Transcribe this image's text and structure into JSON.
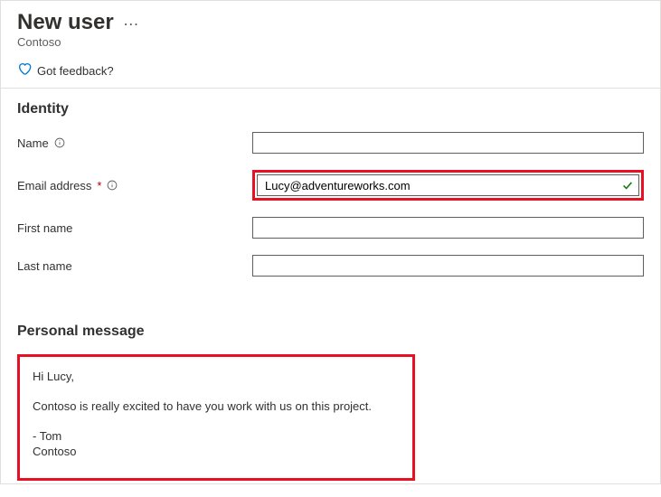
{
  "header": {
    "title": "New user",
    "org": "Contoso",
    "feedback_label": "Got feedback?"
  },
  "sections": {
    "identity": {
      "heading": "Identity",
      "fields": {
        "name_label": "Name",
        "name_value": "",
        "email_label": "Email address",
        "email_value": "Lucy@adventureworks.com",
        "first_name_label": "First name",
        "first_name_value": "",
        "last_name_label": "Last name",
        "last_name_value": ""
      }
    },
    "personal_message": {
      "heading": "Personal message",
      "body_line1": "Hi Lucy,",
      "body_line2": "Contoso is really excited to have you work with us on this project.",
      "body_line3": "- Tom",
      "body_line4": "Contoso"
    }
  },
  "colors": {
    "highlight": "#e81123",
    "link": "#0078d4",
    "success": "#107c10"
  }
}
